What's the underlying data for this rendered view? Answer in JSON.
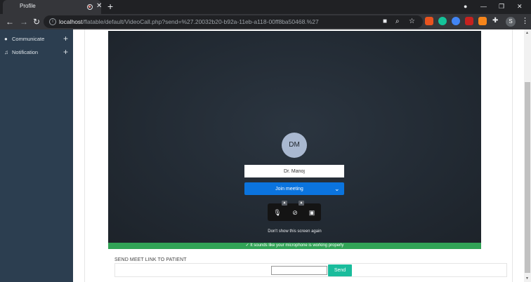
{
  "browser": {
    "tab_title": "Profile",
    "tab_close": "✕",
    "new_tab": "+",
    "url_host": "localhost",
    "url_path": "/flatable/default/VideoCall.php?send=%27.20032b20-b92a-11eb-a118-00ff8ba50468.%27",
    "profile_initial": "S",
    "window_controls": [
      "—",
      "❐",
      "✕"
    ],
    "icons": [
      "back-icon",
      "forward-icon",
      "reload-icon",
      "site-info-icon",
      "camera-icon",
      "zoom-icon",
      "star-icon",
      "extensions-icon",
      "menu-icon"
    ]
  },
  "sidebar": {
    "items": [
      {
        "label": "Communicate",
        "icon": "chat-icon",
        "expand": "+"
      },
      {
        "label": "Notification",
        "icon": "bell-icon",
        "expand": "+"
      }
    ]
  },
  "meeting": {
    "avatar_initials": "DM",
    "name_value": "Dr. Manoj",
    "join_label": "Join meeting",
    "dont_show": "Don't show this screen again",
    "mic_banner": "✓  It sounds like your microphone is working properly",
    "controls": [
      "microphone-icon",
      "camera-off-icon",
      "background-icon"
    ]
  },
  "send_link": {
    "title": "SEND MEET LINK TO PATIENT",
    "input_value": "",
    "button_label": "Send"
  },
  "colors": {
    "sidebar_bg": "#2c3e50",
    "join_blue": "#0b74de",
    "banner_green": "#31a356",
    "send_teal": "#1abc9c"
  }
}
